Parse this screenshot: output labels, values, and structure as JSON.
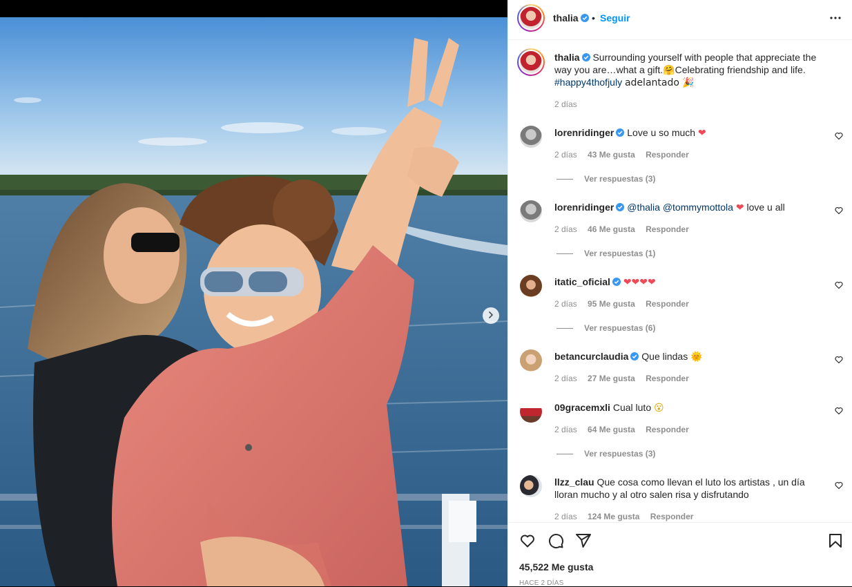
{
  "header": {
    "username": "thalia",
    "separator": "•",
    "follow_label": "Seguir"
  },
  "caption": {
    "username": "thalia",
    "text": "Surrounding yourself with people that appreciate the way you are…what a gift.🤗Celebrating friendship and life.",
    "hashtag": "#happy4thofjuly",
    "text_after": "adelantado 🎉",
    "time": "2 días"
  },
  "comments": [
    {
      "username": "lorenridinger",
      "verified": true,
      "text": "Love u so much",
      "emoji": "❤",
      "time": "2 días",
      "likes": "43 Me gusta",
      "reply_label": "Responder",
      "replies": "Ver respuestas (3)"
    },
    {
      "username": "lorenridinger",
      "verified": true,
      "mention1": "@thalia",
      "mention2": "@tommymottola",
      "emoji": "❤",
      "text": "love u all",
      "time": "2 días",
      "likes": "46 Me gusta",
      "reply_label": "Responder",
      "replies": "Ver respuestas (1)"
    },
    {
      "username": "itatic_oficial",
      "verified": true,
      "emoji": "❤❤❤❤",
      "time": "2 días",
      "likes": "95 Me gusta",
      "reply_label": "Responder",
      "replies": "Ver respuestas (6)"
    },
    {
      "username": "betancurclaudia",
      "verified": true,
      "text": "Que lindas",
      "emoji": "🌞",
      "time": "2 días",
      "likes": "27 Me gusta",
      "reply_label": "Responder"
    },
    {
      "username": "09gracemxli",
      "verified": false,
      "text": "Cual luto",
      "emoji": "😮",
      "time": "2 días",
      "likes": "64 Me gusta",
      "reply_label": "Responder",
      "replies": "Ver respuestas (3)"
    },
    {
      "username": "llzz_clau",
      "verified": false,
      "text": "Que cosa como llevan el luto los artistas , un día lloran mucho y al otro salen risa y disfrutando",
      "time": "2 días",
      "likes": "124 Me gusta",
      "reply_label": "Responder"
    }
  ],
  "footer": {
    "likes": "45,522 Me gusta",
    "date": "HACE 2 DÍAS"
  },
  "icons": {
    "more": "more-options-icon",
    "next": "chevron-right-icon",
    "like": "heart-icon",
    "comment": "comment-icon",
    "share": "send-icon",
    "save": "bookmark-icon",
    "verified": "verified-badge-icon"
  },
  "colors": {
    "follow": "#0095f6",
    "verified": "#3897f0",
    "hashtag": "#00376b",
    "heart": "#ed4956",
    "muted": "#8e8e8e",
    "text": "#262626"
  }
}
